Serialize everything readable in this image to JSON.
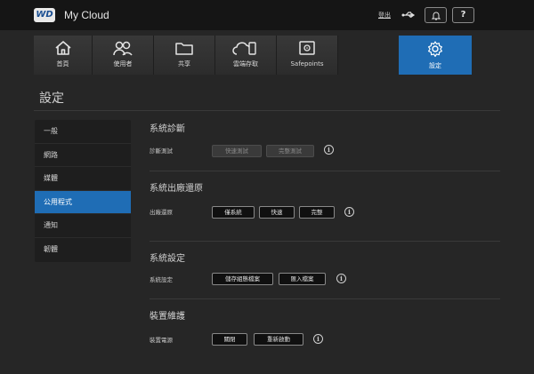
{
  "header": {
    "logo_text": "WD",
    "app_title": "My Cloud",
    "logout": "登出",
    "help_label": "?"
  },
  "nav": {
    "items": [
      {
        "label": "首頁",
        "icon": "home-icon"
      },
      {
        "label": "使用者",
        "icon": "users-icon"
      },
      {
        "label": "共享",
        "icon": "folder-icon"
      },
      {
        "label": "雲端存取",
        "icon": "cloud-access-icon"
      },
      {
        "label": "Safepoints",
        "icon": "safepoints-icon"
      },
      {
        "label": "設定",
        "icon": "gear-icon"
      }
    ],
    "active": "設定",
    "accent": "#1f6db5"
  },
  "page_title": "設定",
  "sidebar": {
    "items": [
      "一般",
      "網路",
      "媒體",
      "公用程式",
      "通知",
      "韌體"
    ],
    "active_index": 3
  },
  "sections": {
    "diagnostics": {
      "title": "系統診斷",
      "row_label": "診斷測試",
      "buttons": [
        "快速測試",
        "完整測試"
      ]
    },
    "restore": {
      "title": "系統出廠還原",
      "row_label": "出廠還原",
      "buttons": [
        "僅系統",
        "快速",
        "完整"
      ]
    },
    "config": {
      "title": "系統設定",
      "row_label": "系統設定",
      "buttons": [
        "儲存組態檔案",
        "匯入檔案"
      ]
    },
    "maintenance": {
      "title": "裝置維護",
      "row_label": "裝置電源",
      "buttons": [
        "關閉",
        "重新啟動"
      ]
    }
  },
  "info_glyph": "i"
}
